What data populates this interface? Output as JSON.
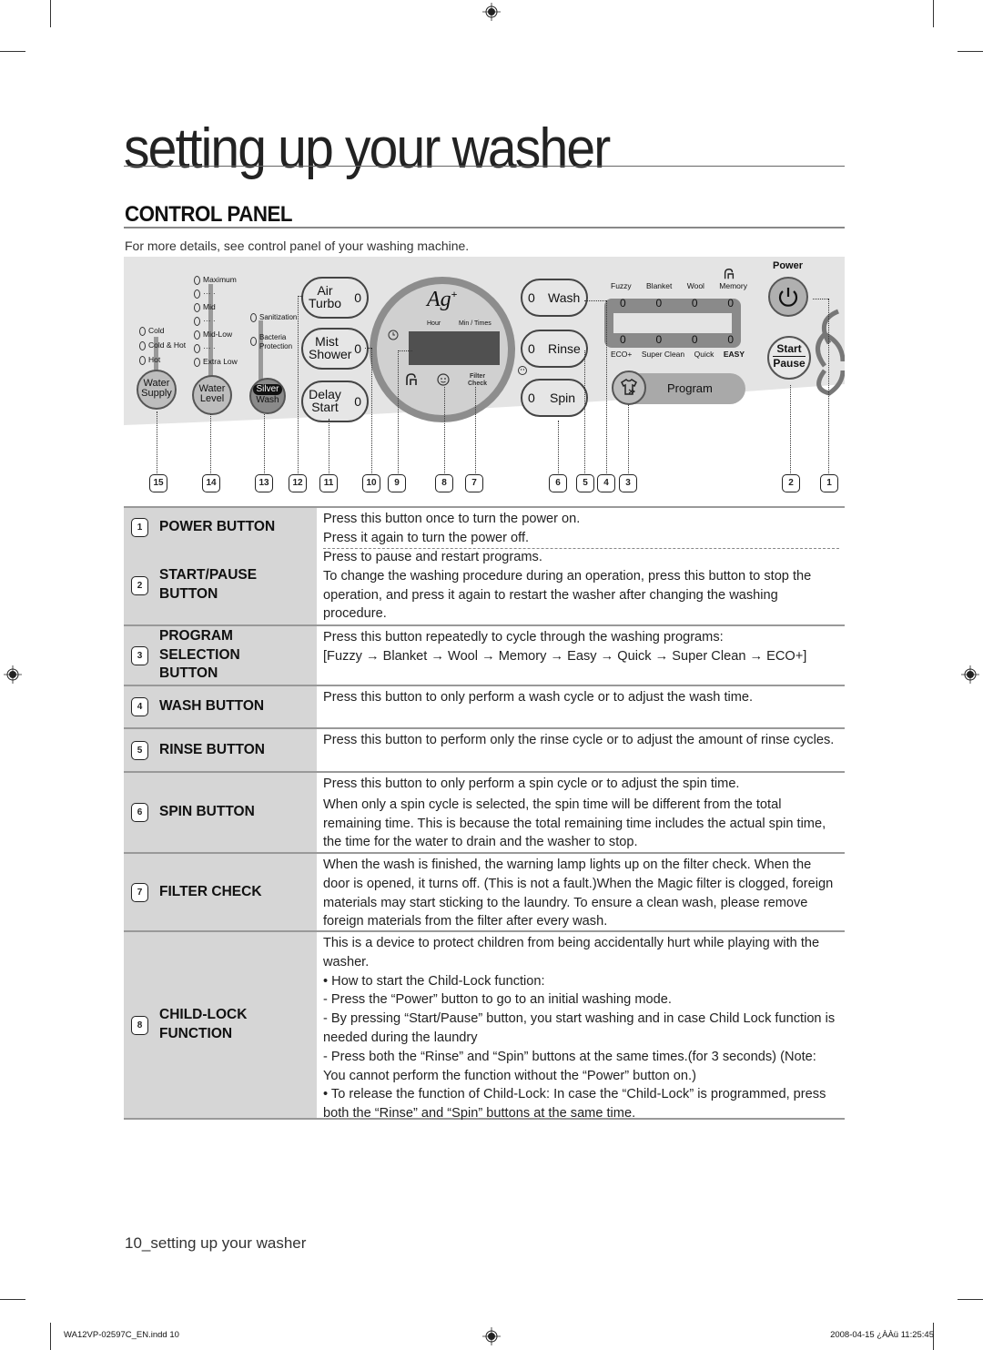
{
  "page": {
    "title": "setting up your washer",
    "section_title": "CONTROL PANEL",
    "intro": "For more details, see control panel of your washing machine.",
    "footer_page_label": "10_setting up your washer",
    "print_file": "WA12VP-02597C_EN.indd   10",
    "print_timestamp": "2008-04-15   ¿ÀÀü 11:25:45"
  },
  "panel": {
    "water_supply": {
      "label_line1": "Water",
      "label_line2": "Supply",
      "options": [
        "Cold",
        "Cold & Hot",
        "Hot"
      ]
    },
    "water_level": {
      "label_line1": "Water",
      "label_line2": "Level",
      "options": [
        "Maximum",
        "··· ·",
        "Mid",
        "··· ·",
        "Mid-Low",
        "··· ·",
        "Extra Low"
      ]
    },
    "silver_wash": {
      "label_line1": "Silver",
      "label_line2": "Wash",
      "options": [
        "Sanitization",
        "Bacteria",
        "Protection"
      ]
    },
    "air_turbo": {
      "line1": "Air",
      "line2": "Turbo",
      "led": "0"
    },
    "mist_shower": {
      "line1": "Mist",
      "line2": "Shower",
      "led": "0"
    },
    "delay_start": {
      "line1": "Delay",
      "line2": "Start",
      "led": "0"
    },
    "display": {
      "logo": "Ag",
      "logo_sup": "+",
      "hour_label": "Hour",
      "min_label": "Min / Times",
      "filter_line1": "Filter",
      "filter_line2": "Check"
    },
    "wash": {
      "label": "Wash",
      "led": "0"
    },
    "rinse": {
      "label": "Rinse",
      "led": "0"
    },
    "spin": {
      "label": "Spin",
      "led": "0"
    },
    "programs_top": [
      "Fuzzy",
      "Blanket",
      "Wool",
      "Memory"
    ],
    "programs_bottom": [
      "ECO+",
      "Super Clean",
      "Quick",
      "EASY"
    ],
    "program_led": "0",
    "program_button": "Program",
    "power_label": "Power",
    "start_label": "Start",
    "pause_label": "Pause",
    "callouts": [
      "15",
      "14",
      "13",
      "12",
      "11",
      "10",
      "9",
      "8",
      "7",
      "6",
      "5",
      "4",
      "3",
      "2",
      "1"
    ],
    "icons": [
      "clock-icon",
      "child-lock-icon",
      "baby-face-icon",
      "shirt-program-icon",
      "power-icon",
      "flower-decoration-icon"
    ]
  },
  "table": [
    {
      "num": "1",
      "label": [
        "POWER BUTTON"
      ],
      "desc": [
        {
          "text": "Press this button once to turn the power on."
        },
        {
          "text": "Press it again to turn the power off."
        }
      ]
    },
    {
      "num": "2",
      "label": [
        "START/PAUSE",
        "BUTTON"
      ],
      "desc": [
        {
          "text": "Press to pause and restart programs."
        },
        {
          "text": "To change the washing procedure during an operation, press this button to stop the operation, and press it again to restart the washer after changing the washing procedure."
        }
      ]
    },
    {
      "num": "3",
      "label": [
        "PROGRAM",
        "SELECTION",
        "BUTTON"
      ],
      "desc": [
        {
          "text": "Press this button repeatedly to cycle through the washing programs:"
        },
        {
          "text": "[Fuzzy → Blanket → Wool → Memory → Easy → Quick → Super Clean → ECO+]"
        }
      ]
    },
    {
      "num": "4",
      "label": [
        "WASH BUTTON"
      ],
      "desc": [
        {
          "text": "Press this button to only perform a wash cycle or to adjust the wash time."
        }
      ]
    },
    {
      "num": "5",
      "label": [
        "RINSE BUTTON"
      ],
      "desc": [
        {
          "text": "Press this button to perform only the rinse cycle or to adjust the amount of rinse cycles."
        }
      ]
    },
    {
      "num": "6",
      "label": [
        "SPIN BUTTON"
      ],
      "desc": [
        {
          "text": "Press this button to only perform a spin cycle or to adjust the spin time."
        },
        {
          "text": "When only a spin cycle is selected, the spin time will be different from the total remaining time. This is because the total remaining time includes the actual spin time, the time for the water to drain and the washer to stop."
        }
      ]
    },
    {
      "num": "7",
      "label": [
        "FILTER CHECK"
      ],
      "desc": [
        {
          "text": "When the wash is finished, the warning lamp lights up on the filter check. When the door is opened, it turns off. (This is not a fault.)When the Magic filter is clogged, foreign materials may start sticking to the laundry. To ensure a clean wash, please remove foreign materials from the filter after every wash."
        }
      ]
    },
    {
      "num": "8",
      "label": [
        "CHILD-LOCK",
        "FUNCTION"
      ],
      "desc": [
        {
          "text": "This is a device to protect children from being accidentally hurt while playing with the washer."
        },
        {
          "text": "• How to start the Child-Lock function:"
        },
        {
          "text": "- Press the “Power” button to go to an initial washing mode."
        },
        {
          "text": "- By pressing “Start/Pause” button, you start washing and in case Child Lock function is needed during the laundry"
        },
        {
          "text": "- Press both the “Rinse” and “Spin” buttons at the same times.(for 3 seconds) (Note: You cannot perform the function without the “Power” button on.)"
        },
        {
          "text": "• To release the function of Child-Lock: In case the “Child-Lock” is programmed, press both the “Rinse” and “Spin” buttons at the same time."
        }
      ]
    }
  ]
}
